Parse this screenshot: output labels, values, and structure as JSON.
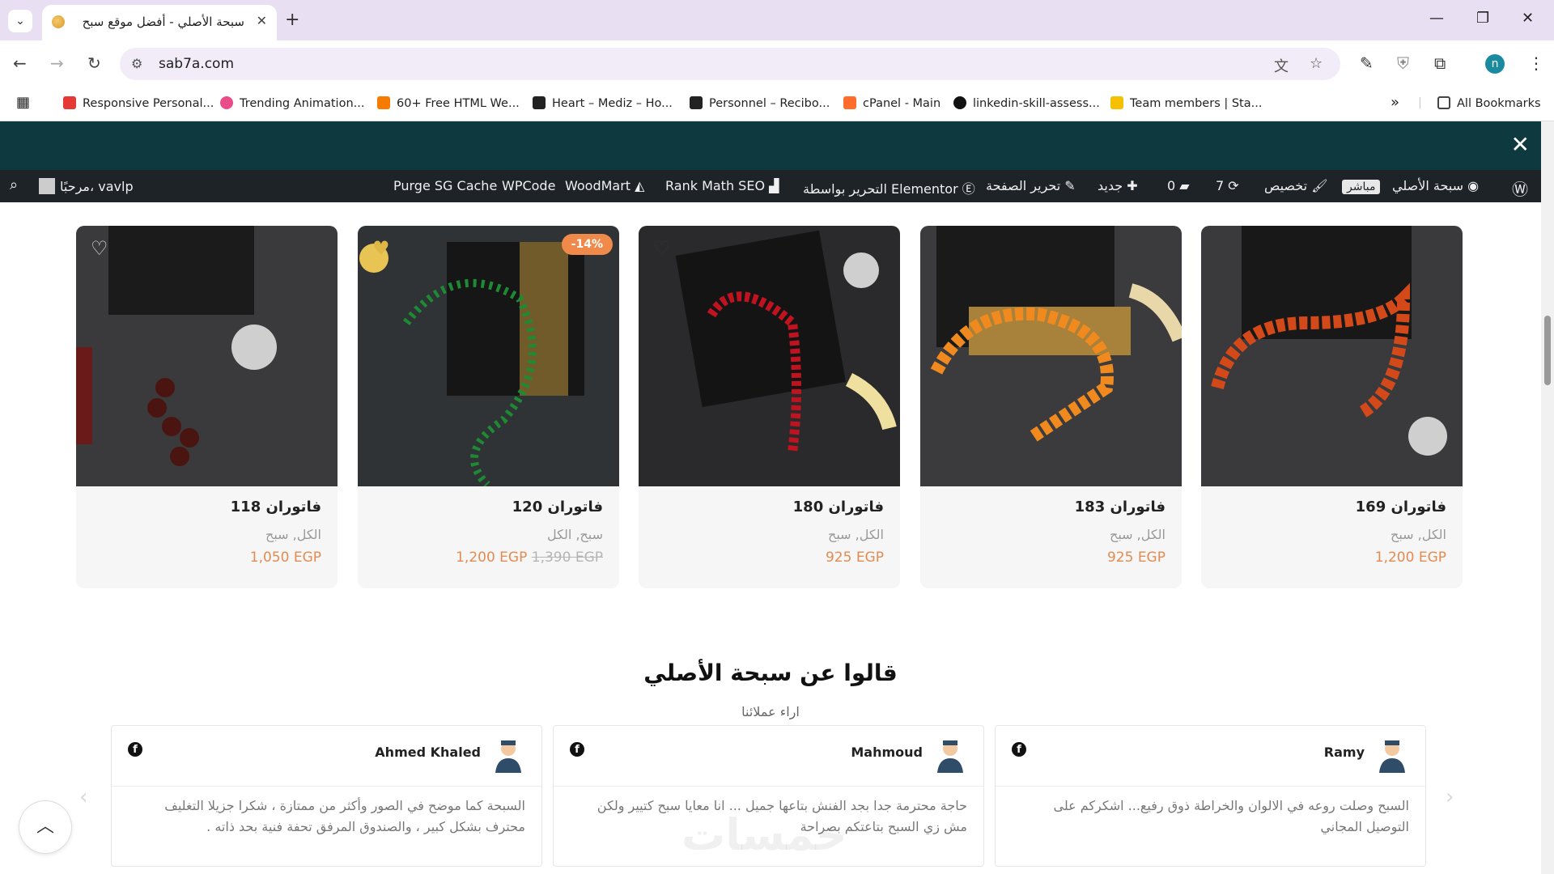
{
  "browser": {
    "tab_title": "سبحة الأصلي - أفضل موقع سبح",
    "url": "sab7a.com",
    "profile_initial": "n",
    "all_bookmarks": "All Bookmarks",
    "bookmarks": [
      {
        "label": "Responsive Personal...",
        "color": "#e53935"
      },
      {
        "label": "Trending Animation...",
        "color": "#ea4c89"
      },
      {
        "label": "60+ Free HTML We...",
        "color": "#f57c00"
      },
      {
        "label": "Heart – Mediz – Ho...",
        "color": "#222222"
      },
      {
        "label": "Personnel – Recibo...",
        "color": "#222222"
      },
      {
        "label": "cPanel - Main",
        "color": "#ff6c2c"
      },
      {
        "label": "linkedin-skill-assess...",
        "color": "#111111"
      },
      {
        "label": "Team members | Sta...",
        "color": "#f5c000"
      }
    ]
  },
  "adminbar": {
    "greeting": "مرحبًا، vavlp",
    "purge": "Purge SG Cache",
    "wpcode": "WPCode",
    "woodmart": "WoodMart",
    "rankmath": "Rank Math SEO",
    "elementor": "التحرير بواسطة Elementor",
    "edit_page": "تحرير الصفحة",
    "new": "جديد",
    "comments": "0",
    "updates": "7",
    "customize": "تخصيص",
    "live": "مباشر",
    "site_name": "سبحة الأصلي"
  },
  "products": [
    {
      "title": "فاتوران 118",
      "cats": "الكل, سبح",
      "price": "1,050 EGP",
      "old_price": "",
      "badge": ""
    },
    {
      "title": "فاتوران 120",
      "cats": "سبح, الكل",
      "price": "1,200 EGP",
      "old_price": "1,390 EGP",
      "badge": "-14%"
    },
    {
      "title": "فاتوران 180",
      "cats": "الكل, سبح",
      "price": "925 EGP",
      "old_price": "",
      "badge": ""
    },
    {
      "title": "فاتوران 183",
      "cats": "الكل, سبح",
      "price": "925 EGP",
      "old_price": "",
      "badge": ""
    },
    {
      "title": "فاتوران 169",
      "cats": "الكل, سبح",
      "price": "1,200 EGP",
      "old_price": "",
      "badge": ""
    }
  ],
  "testimonials": {
    "title": "قالوا عن سبحة الأصلي",
    "subtitle": "اراء عملائنا",
    "items": [
      {
        "name": "Ahmed Khaled",
        "text": "السبحة كما موضح في الصور وأكثر من ممتازة ، شكرا جزيلا التغليف محترف بشكل كبير ، والصندوق المرفق تحفة فنية بحد ذاته ."
      },
      {
        "name": "Mahmoud",
        "text": "حاجة محترمة جدا بجد الفنش بتاعها جميل ... انا معايا سبح كتيير ولكن مش زي السبح بتاعتكم بصراحة"
      },
      {
        "name": "Ramy",
        "text": "السبح وصلت روعه في الالوان والخراطة ذوق رفيع... اشكركم على التوصيل المجاني"
      }
    ]
  },
  "watermark": "خمسات"
}
